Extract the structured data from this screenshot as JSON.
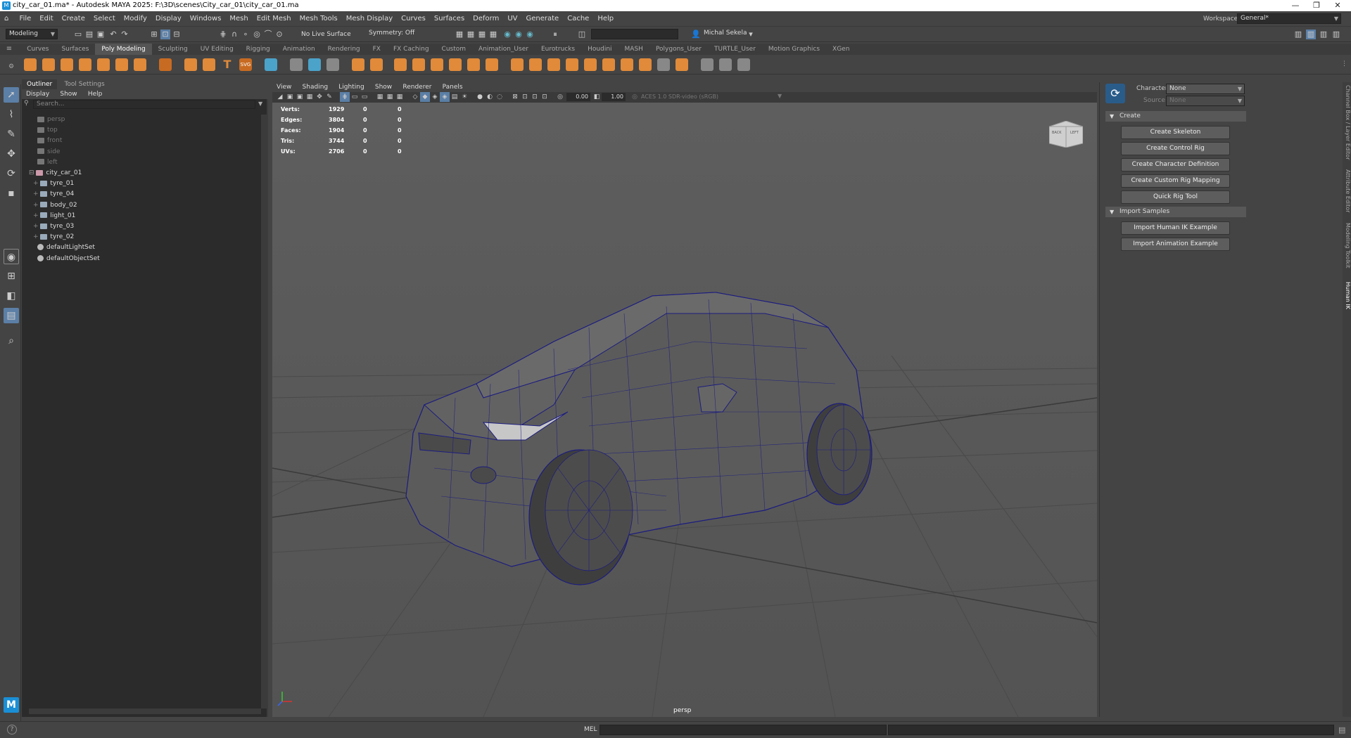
{
  "window": {
    "title": "city_car_01.ma* - Autodesk MAYA 2025: F:\\3D\\scenes\\City_car_01\\city_car_01.ma",
    "app_icon": "M",
    "minimize": "—",
    "restore": "❐",
    "close": "✕"
  },
  "menubar": {
    "items": [
      "File",
      "Edit",
      "Create",
      "Select",
      "Modify",
      "Display",
      "Windows",
      "Mesh",
      "Edit Mesh",
      "Mesh Tools",
      "Mesh Display",
      "Curves",
      "Surfaces",
      "Deform",
      "UV",
      "Generate",
      "Cache",
      "Help"
    ],
    "workspace_label": "Workspace:",
    "workspace_value": "General*"
  },
  "statusline": {
    "mode": "Modeling",
    "live_surface": "No Live Surface",
    "symmetry": "Symmetry: Off",
    "user": "Michal Sekela"
  },
  "shelf": {
    "tabs": [
      "Curves",
      "Surfaces",
      "Poly Modeling",
      "Sculpting",
      "UV Editing",
      "Rigging",
      "Animation",
      "Rendering",
      "FX",
      "FX Caching",
      "Custom",
      "Animation_User",
      "Eurotrucks",
      "Houdini",
      "MASH",
      "Polygons_User",
      "TURTLE_User",
      "Motion Graphics",
      "XGen"
    ],
    "active_tab": "Poly Modeling"
  },
  "outliner": {
    "tabs": [
      "Outliner",
      "Tool Settings"
    ],
    "menu": [
      "Display",
      "Show",
      "Help"
    ],
    "search_placeholder": "Search...",
    "items": [
      {
        "label": "persp",
        "dim": true,
        "indent": 0
      },
      {
        "label": "top",
        "dim": true,
        "indent": 0
      },
      {
        "label": "front",
        "dim": true,
        "indent": 0
      },
      {
        "label": "side",
        "dim": true,
        "indent": 0
      },
      {
        "label": "left",
        "dim": true,
        "indent": 0
      },
      {
        "label": "city_car_01",
        "dim": false,
        "indent": 0
      },
      {
        "label": "tyre_01",
        "dim": false,
        "indent": 1
      },
      {
        "label": "tyre_04",
        "dim": false,
        "indent": 1
      },
      {
        "label": "body_02",
        "dim": false,
        "indent": 1
      },
      {
        "label": "light_01",
        "dim": false,
        "indent": 1
      },
      {
        "label": "tyre_03",
        "dim": false,
        "indent": 1
      },
      {
        "label": "tyre_02",
        "dim": false,
        "indent": 1
      },
      {
        "label": "defaultLightSet",
        "dim": false,
        "indent": 0
      },
      {
        "label": "defaultObjectSet",
        "dim": false,
        "indent": 0
      }
    ]
  },
  "viewport": {
    "menu": [
      "View",
      "Shading",
      "Lighting",
      "Show",
      "Renderer",
      "Panels"
    ],
    "toolbar_value_1": "0.00",
    "toolbar_value_2": "1.00",
    "color_space": "ACES 1.0 SDR-video (sRGB)",
    "camera_label": "persp",
    "viewcube_back": "BACK",
    "viewcube_left": "LEFT",
    "hud": [
      {
        "label": "Verts:",
        "v1": "1929",
        "v2": "0",
        "v3": "0"
      },
      {
        "label": "Edges:",
        "v1": "3804",
        "v2": "0",
        "v3": "0"
      },
      {
        "label": "Faces:",
        "v1": "1904",
        "v2": "0",
        "v3": "0"
      },
      {
        "label": "Tris:",
        "v1": "3744",
        "v2": "0",
        "v3": "0"
      },
      {
        "label": "UVs:",
        "v1": "2706",
        "v2": "0",
        "v3": "0"
      }
    ]
  },
  "hik": {
    "character_label": "Character:",
    "character_value": "None",
    "source_label": "Source:",
    "source_value": "None",
    "create_section": "Create",
    "create_buttons": [
      "Create Skeleton",
      "Create Control Rig",
      "Create Character Definition",
      "Create Custom Rig Mapping",
      "Quick Rig Tool"
    ],
    "samples_section": "Import Samples",
    "sample_buttons": [
      "Import Human IK Example",
      "Import Animation Example"
    ]
  },
  "side_tabs": [
    "Channel Box / Layer Editor",
    "Attribute Editor",
    "Modeling Toolkit",
    "Human IK"
  ],
  "cmdline": {
    "mel_label": "MEL",
    "help_icon": "?"
  }
}
